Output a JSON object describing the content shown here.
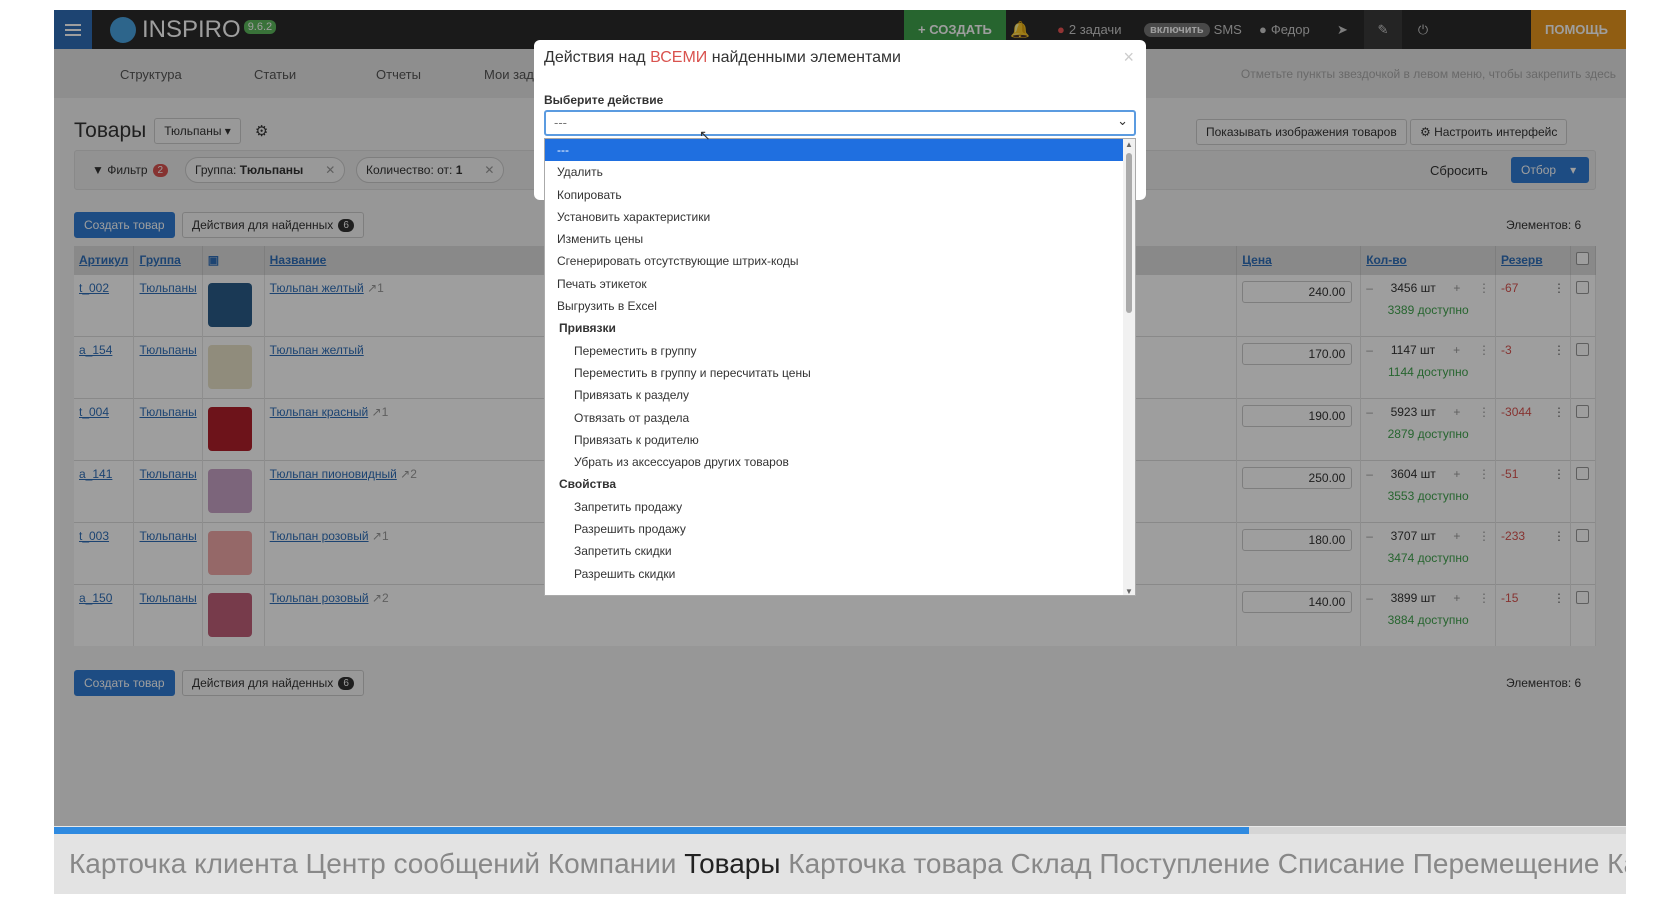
{
  "app": {
    "name": "INSPIRO",
    "version": "9.6.2"
  },
  "topbar": {
    "create": "+ СОЗДАТЬ",
    "tasks": "2 задачи",
    "sms_toggle": "включить",
    "sms": "SMS",
    "user": "Федор",
    "help": "ПОМОЩЬ"
  },
  "menu": {
    "items": [
      "Структура",
      "Статьи",
      "Отчеты",
      "Мои задачи"
    ],
    "hint": "Отметьте пункты звездочкой в левом меню, чтобы закрепить здесь"
  },
  "page": {
    "title": "Товары",
    "group_select": "Тюльпаны",
    "show_images": "Показывать изображения товаров",
    "customize": "Настроить интерфейс"
  },
  "filters": {
    "filter_label": "Фильтр",
    "filter_count": "2",
    "chip_group_key": "Группа:",
    "chip_group_val": "Тюльпаны",
    "chip_qty_key": "Количество: от:",
    "chip_qty_val": "1",
    "reset": "Сбросить",
    "select_btn": "Отбор"
  },
  "actions": {
    "create": "Создать товар",
    "found_actions": "Действия для найденных",
    "found_count": "6",
    "elements": "Элементов: 6"
  },
  "table": {
    "headers": {
      "sku": "Артикул",
      "group": "Группа",
      "name": "Название",
      "price": "Цена",
      "qty": "Кол-во",
      "reserve": "Резерв"
    },
    "rows": [
      {
        "sku": "t_002",
        "group": "Тюльпаны",
        "name": "Тюльпан желтый",
        "links": "1",
        "price": "240.00",
        "qty": "3456 шт",
        "avail": "3389 доступно",
        "reserve": "-67",
        "color": "#2a5d8a"
      },
      {
        "sku": "a_154",
        "group": "Тюльпаны",
        "name": "Тюльпан желтый",
        "links": "",
        "price": "170.00",
        "qty": "1147 шт",
        "avail": "1144 доступно",
        "reserve": "-3",
        "color": "#e8e2c8"
      },
      {
        "sku": "t_004",
        "group": "Тюльпаны",
        "name": "Тюльпан красный",
        "links": "1",
        "price": "190.00",
        "qty": "5923 шт",
        "avail": "2879 доступно",
        "reserve": "-3044",
        "color": "#b01f2a"
      },
      {
        "sku": "a_141",
        "group": "Тюльпаны",
        "name": "Тюльпан пионовидный",
        "links": "2",
        "price": "250.00",
        "qty": "3604 шт",
        "avail": "3553 доступно",
        "reserve": "-51",
        "color": "#c9a3c7"
      },
      {
        "sku": "t_003",
        "group": "Тюльпаны",
        "name": "Тюльпан розовый",
        "links": "1",
        "price": "180.00",
        "qty": "3707 шт",
        "avail": "3474 доступно",
        "reserve": "-233",
        "color": "#f0a8a8"
      },
      {
        "sku": "a_150",
        "group": "Тюльпаны",
        "name": "Тюльпан розовый",
        "links": "2",
        "price": "140.00",
        "qty": "3899 шт",
        "avail": "3884 доступно",
        "reserve": "-15",
        "color": "#c0607a"
      }
    ]
  },
  "modal": {
    "title_pre": "Действия над",
    "title_em": "ВСЕМИ",
    "title_post": "найденными элементами",
    "label": "Выберите действие",
    "selected": "---",
    "options": [
      {
        "t": "---",
        "k": "sel"
      },
      {
        "t": "Удалить",
        "k": "opt"
      },
      {
        "t": "Копировать",
        "k": "opt"
      },
      {
        "t": "Установить характеристики",
        "k": "opt"
      },
      {
        "t": "Изменить цены",
        "k": "opt"
      },
      {
        "t": "Сгенерировать отсутствующие штрих-коды",
        "k": "opt"
      },
      {
        "t": "Печать этикеток",
        "k": "opt"
      },
      {
        "t": "Выгрузить в Excel",
        "k": "opt"
      },
      {
        "t": "Привязки",
        "k": "grp"
      },
      {
        "t": "Переместить в группу",
        "k": "sub"
      },
      {
        "t": "Переместить в группу и пересчитать цены",
        "k": "sub"
      },
      {
        "t": "Привязать к разделу",
        "k": "sub"
      },
      {
        "t": "Отвязать от раздела",
        "k": "sub"
      },
      {
        "t": "Привязать к родителю",
        "k": "sub"
      },
      {
        "t": "Убрать из аксессуаров других товаров",
        "k": "sub"
      },
      {
        "t": "Свойства",
        "k": "grp"
      },
      {
        "t": "Запретить продажу",
        "k": "sub"
      },
      {
        "t": "Разрешить продажу",
        "k": "sub"
      },
      {
        "t": "Запретить скидки",
        "k": "sub"
      },
      {
        "t": "Разрешить скидки",
        "k": "sub"
      }
    ]
  },
  "progress": 0.76,
  "ticker": {
    "before": "Карточка клиента Центр сообщений Компании ",
    "active": "Товары",
    "after": " Карточка товара Склад Поступление Списание Перемещение Ка"
  }
}
